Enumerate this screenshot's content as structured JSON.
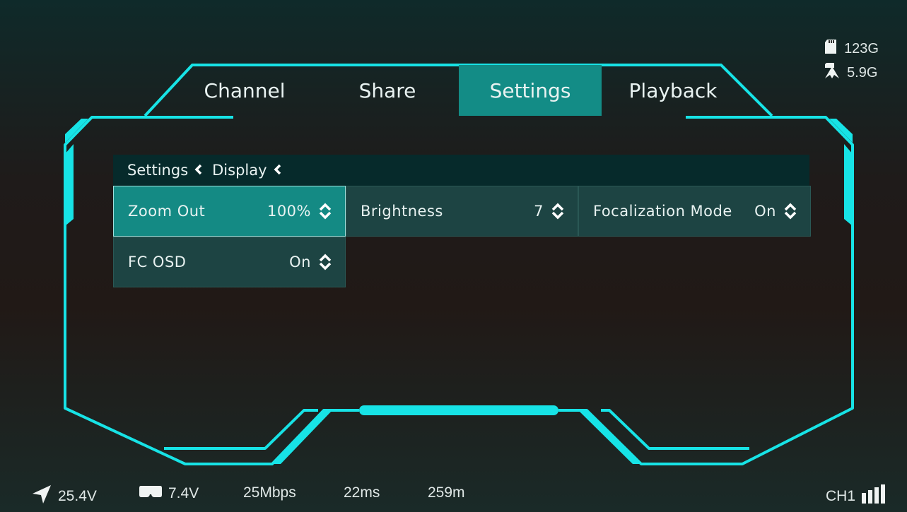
{
  "tabs": [
    {
      "label": "Channel",
      "active": false
    },
    {
      "label": "Share",
      "active": false
    },
    {
      "label": "Settings",
      "active": true
    },
    {
      "label": "Playback",
      "active": false
    }
  ],
  "storage": {
    "sd_card": "123G",
    "recorded": "5.9G"
  },
  "breadcrumb": {
    "level1": "Settings",
    "level2": "Display"
  },
  "settings": [
    {
      "label": "Zoom Out",
      "value": "100%",
      "active": true
    },
    {
      "label": "Brightness",
      "value": "7",
      "active": false
    },
    {
      "label": "Focalization Mode",
      "value": "On",
      "active": false
    },
    {
      "label": "FC OSD",
      "value": "On",
      "active": false
    }
  ],
  "status_bar": {
    "drone_voltage": "25.4V",
    "goggle_voltage": "7.4V",
    "bitrate": "25Mbps",
    "latency": "22ms",
    "distance": "259m",
    "channel": "CH1"
  },
  "colors": {
    "accent": "#17e3e6",
    "active_tab": "#138c86",
    "cell_bg": "#1d4443",
    "breadcrumb_bg": "#062a2b"
  },
  "icons": {
    "sd": "sd-card-icon",
    "recorded": "recorded-storage-icon",
    "drone": "drone-direction-icon",
    "goggles": "goggles-icon",
    "signal": "signal-bars-icon"
  }
}
